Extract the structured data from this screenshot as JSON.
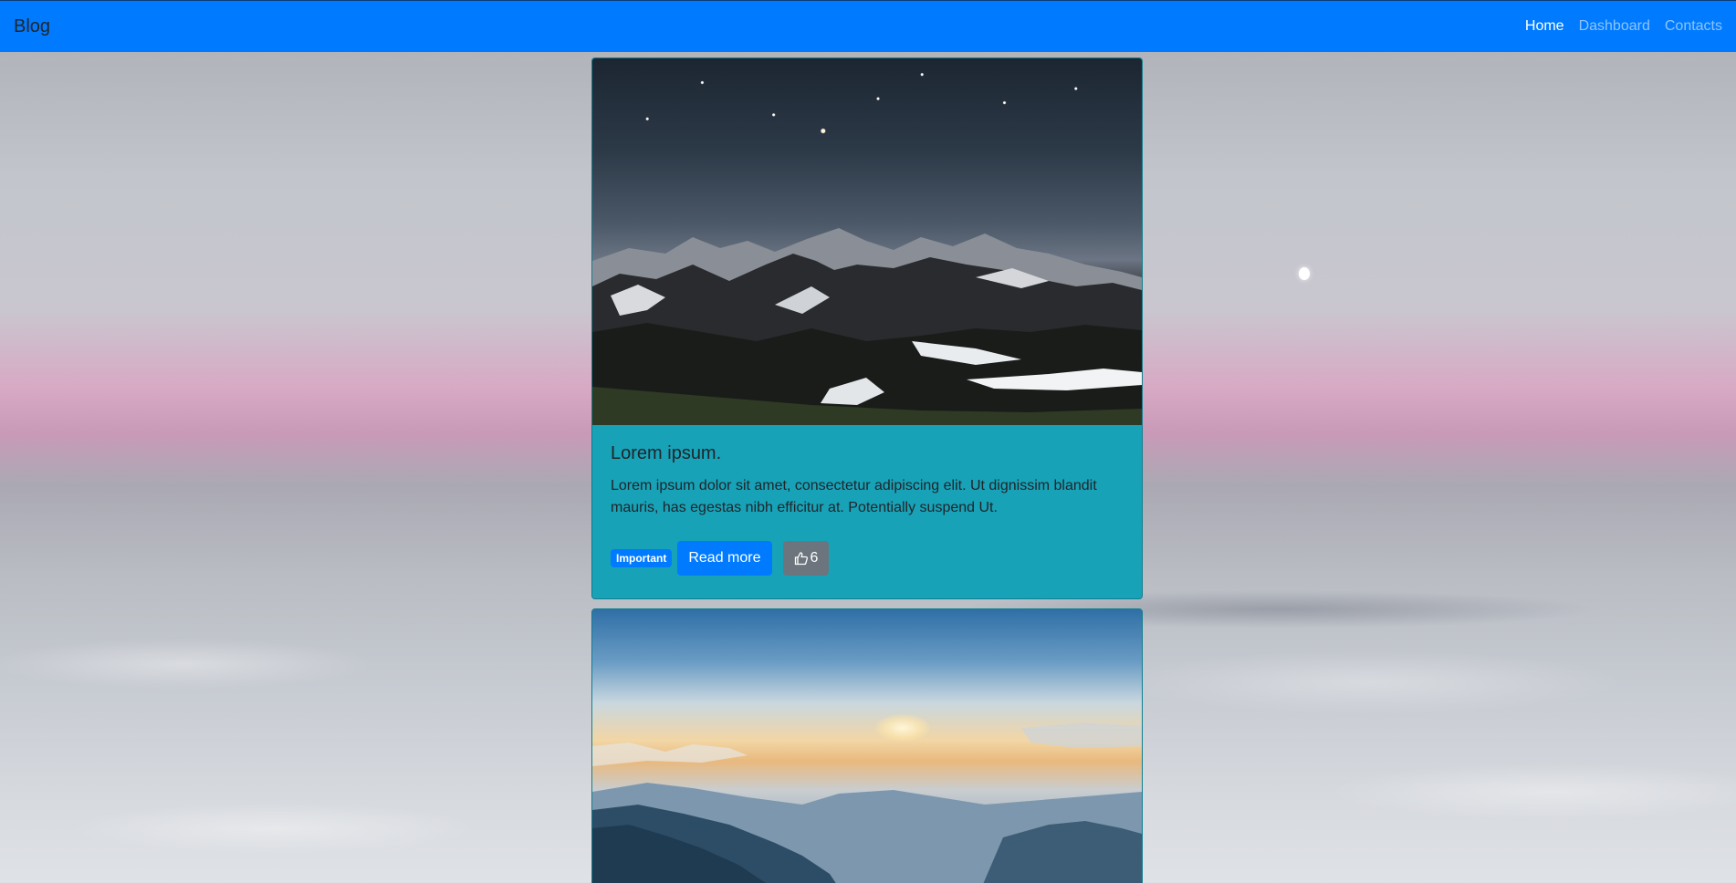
{
  "navbar": {
    "brand": "Blog",
    "links": [
      {
        "label": "Home",
        "active": true
      },
      {
        "label": "Dashboard",
        "active": false
      },
      {
        "label": "Contacts",
        "active": false
      }
    ]
  },
  "posts": [
    {
      "title": "Lorem ipsum.",
      "text": "Lorem ipsum dolor sit amet, consectetur adipiscing elit. Ut dignissim blandit mauris, has egestas nibh efficitur at. Potentially suspend Ut.",
      "badge": "Important",
      "read_more_label": "Read more",
      "likes": "6",
      "like_icon": "thumbs-up-icon"
    }
  ],
  "colors": {
    "navbar": "#007bff",
    "card": "#17a2b8",
    "badge": "#007bff",
    "primary_button": "#007bff",
    "like_button": "#6c757d"
  }
}
